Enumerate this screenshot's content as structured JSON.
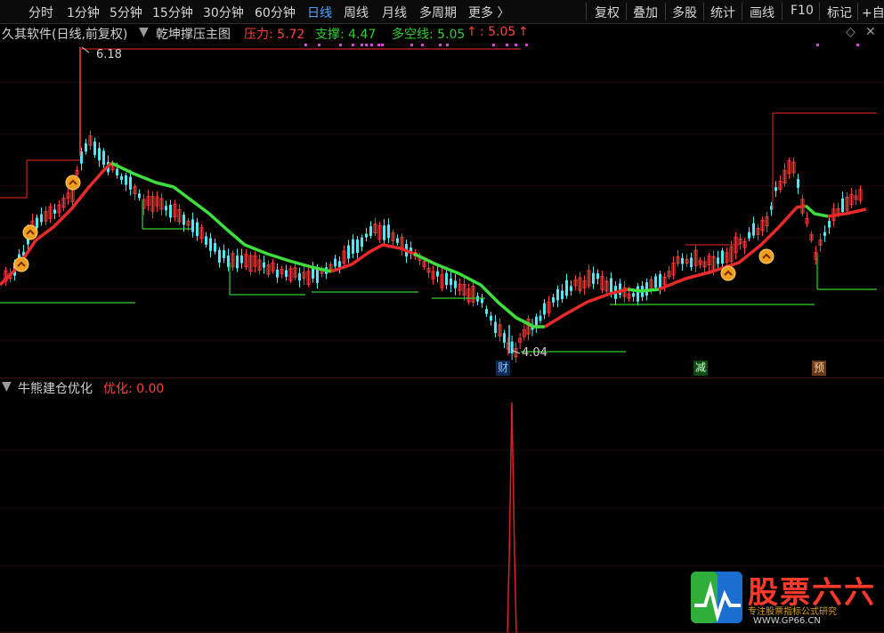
{
  "toolbar": {
    "periods": [
      "分时",
      "1分钟",
      "5分钟",
      "15分钟",
      "30分钟",
      "60分钟",
      "日线",
      "周线",
      "月线",
      "多周期",
      "更多 〉"
    ],
    "active_period": "日线",
    "actions": [
      "复权",
      "叠加",
      "多股",
      "统计",
      "画线",
      "F10",
      "标记",
      "+自"
    ]
  },
  "main_panel": {
    "title": "久其软件(日线,前复权)",
    "indicator_name": "乾坤撑压主图",
    "pressure_label": "压力: 5.72",
    "support_label": "支撑: 4.47",
    "longshort_label": "多空线: 5.05",
    "extra_label": ": 5.05",
    "high_marker": "6.18",
    "low_marker": "4.04",
    "event_tags": [
      "财",
      "减",
      "预"
    ]
  },
  "sub_panel": {
    "title": "牛熊建仓优化",
    "value_label": "优化: 0.00"
  },
  "logo": {
    "brand": "股票六六",
    "slogan": "专注股票指标公式研究",
    "url": "WWW.GP66.CN"
  },
  "colors": {
    "up": "#ff3b3b",
    "down": "#54e6f2",
    "ma_up": "#e82a2a",
    "ma_down": "#3dde3d",
    "support": "#2fcf2f",
    "accent_blue": "#4fa3ff"
  }
}
